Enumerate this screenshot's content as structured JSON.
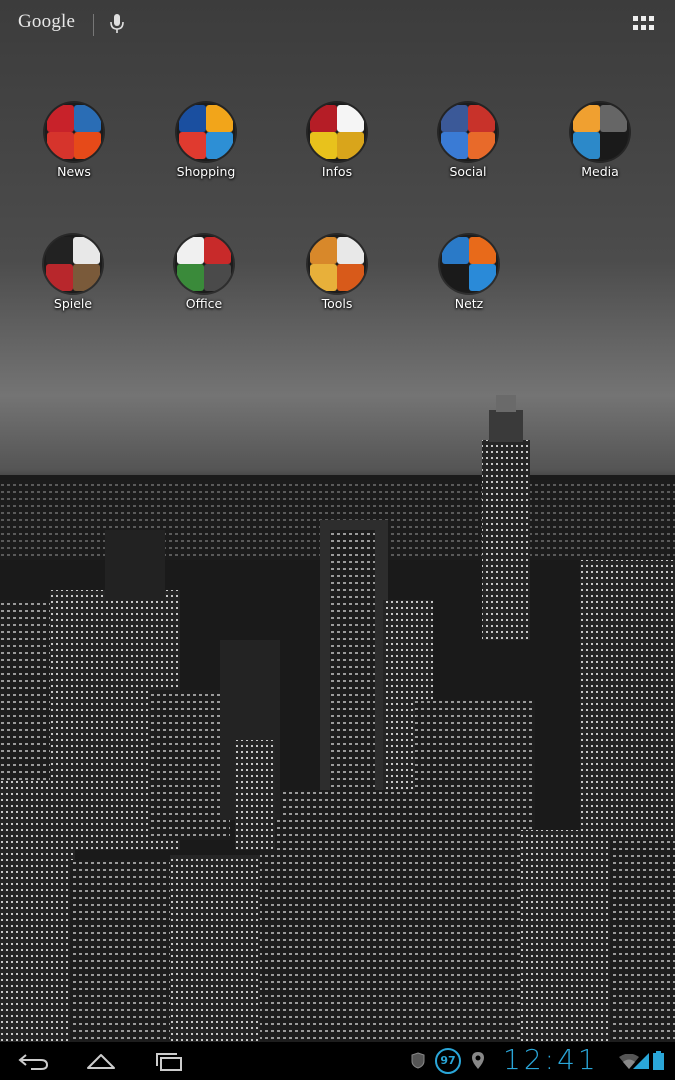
{
  "topbar": {
    "google_label": "Google",
    "mic_icon": "microphone-icon",
    "apps_icon": "all-apps-grid-icon"
  },
  "folders": [
    {
      "label": "News",
      "colors": [
        "#c8222a",
        "#2a6db5",
        "#d6342c",
        "#e64a19"
      ]
    },
    {
      "label": "Shopping",
      "colors": [
        "#1a4fa0",
        "#f2a51a",
        "#e03a2f",
        "#2d8fd5"
      ]
    },
    {
      "label": "Infos",
      "colors": [
        "#b51d26",
        "#f5f5f5",
        "#e8c21c",
        "#d9a51b"
      ]
    },
    {
      "label": "Social",
      "colors": [
        "#3b5998",
        "#c8322a",
        "#3a7bd5",
        "#e86a2a"
      ]
    },
    {
      "label": "Media",
      "colors": [
        "#f0a030",
        "#666666",
        "#2c89c9",
        "#1a1a1a"
      ]
    },
    {
      "label": "Spiele",
      "colors": [
        "#222222",
        "#e8e8e8",
        "#b8272c",
        "#7a5a3a"
      ]
    },
    {
      "label": "Office",
      "colors": [
        "#f0f0f0",
        "#c82a2a",
        "#3a8a3a",
        "#4a4a4a"
      ]
    },
    {
      "label": "Tools",
      "colors": [
        "#d8882a",
        "#e8e8e8",
        "#e8b03a",
        "#d85a1a"
      ]
    },
    {
      "label": "Netz",
      "colors": [
        "#2a7ac8",
        "#e86a1a",
        "#1a1a1a",
        "#2a8ad8"
      ]
    }
  ],
  "navbar": {
    "back_icon": "back-arrow-icon",
    "home_icon": "home-icon",
    "recents_icon": "recent-apps-icon"
  },
  "status": {
    "battery_percent": "97",
    "time": "12:41",
    "accent_color": "#2aa6d8"
  }
}
